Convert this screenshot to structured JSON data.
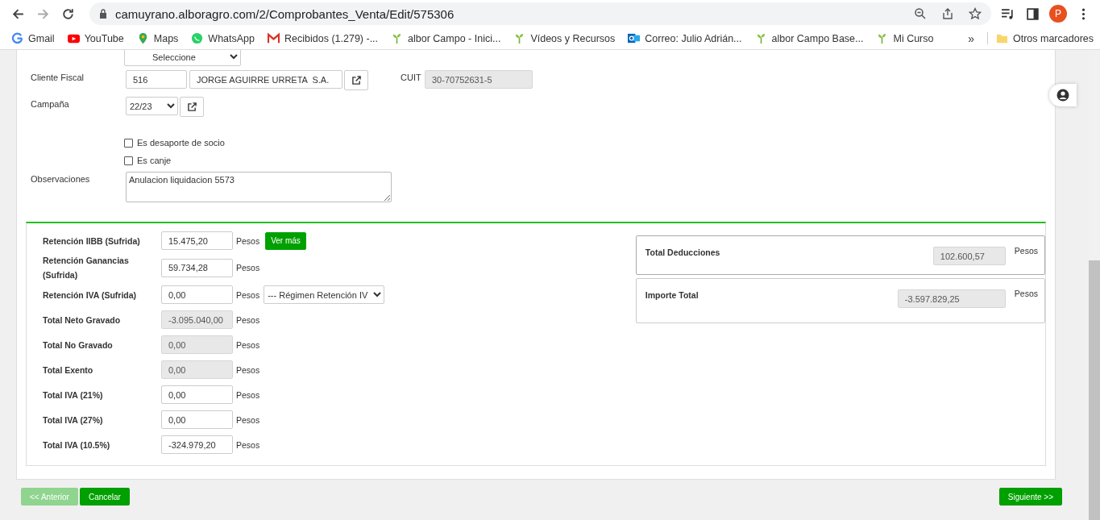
{
  "browser": {
    "url": "camuyrano.alboragro.com/2/Comprobantes_Venta/Edit/575306",
    "profile_initial": "P",
    "bookmarks": [
      {
        "label": "Gmail",
        "kind": "g"
      },
      {
        "label": "YouTube",
        "kind": "yt"
      },
      {
        "label": "Maps",
        "kind": "maps"
      },
      {
        "label": "WhatsApp",
        "kind": "wa"
      },
      {
        "label": "Recibidos (1.279) -...",
        "kind": "mail"
      },
      {
        "label": "albor Campo - Inici...",
        "kind": "sprout"
      },
      {
        "label": "Vídeos y Recursos",
        "kind": "sprout"
      },
      {
        "label": "Correo: Julio Adrián...",
        "kind": "outlook"
      },
      {
        "label": "albor Campo Base...",
        "kind": "sprout"
      },
      {
        "label": "Mi Curso",
        "kind": "sprout"
      }
    ],
    "more": "»",
    "other_bookmarks": "Otros marcadores"
  },
  "form": {
    "top_select": "Seleccione",
    "cliente_fiscal": {
      "label": "Cliente Fiscal",
      "code": "516",
      "name": "JORGE AGUIRRE URRETA  S.A.",
      "cuit_label": "CUIT",
      "cuit": "30-70752631-5"
    },
    "campana": {
      "label": "Campaña",
      "value": "22/23"
    },
    "checkboxes": [
      {
        "label": "Es desaporte de socio",
        "checked": false
      },
      {
        "label": "Es canje",
        "checked": false
      }
    ],
    "observaciones": {
      "label": "Observaciones",
      "value": "Anulacion liquidacion 5573"
    }
  },
  "totals": [
    {
      "label": "Retención IIBB (Sufrida)",
      "value": "15.475,20",
      "unit": "Pesos",
      "readonly": false,
      "button": "Ver más"
    },
    {
      "label": "Retención Ganancias (Sufrida)",
      "value": "59.734,28",
      "unit": "Pesos",
      "readonly": false
    },
    {
      "label": "Retención IVA (Sufrida)",
      "value": "0,00",
      "unit": "Pesos",
      "readonly": false,
      "select": "--- Régimen Retención IV"
    },
    {
      "label": "Total Neto Gravado",
      "value": "-3.095.040,00",
      "unit": "Pesos",
      "readonly": true
    },
    {
      "label": "Total No Gravado",
      "value": "0,00",
      "unit": "Pesos",
      "readonly": true
    },
    {
      "label": "Total Exento",
      "value": "0,00",
      "unit": "Pesos",
      "readonly": true
    },
    {
      "label": "Total IVA (21%)",
      "value": "0,00",
      "unit": "Pesos",
      "readonly": false
    },
    {
      "label": "Total IVA (27%)",
      "value": "0,00",
      "unit": "Pesos",
      "readonly": false
    },
    {
      "label": "Total IVA (10.5%)",
      "value": "-324.979,20",
      "unit": "Pesos",
      "readonly": false
    }
  ],
  "summary": [
    {
      "label": "Total Deducciones",
      "value": "102.600,57",
      "unit": "Pesos"
    },
    {
      "label": "Importe Total",
      "value": "-3.597.829,25",
      "unit": "Pesos"
    }
  ],
  "footer": [
    {
      "label": "<< Anterior",
      "disabled": true
    },
    {
      "label": "Cancelar",
      "disabled": false
    },
    {
      "label": "Siguiente >>",
      "disabled": false
    }
  ]
}
